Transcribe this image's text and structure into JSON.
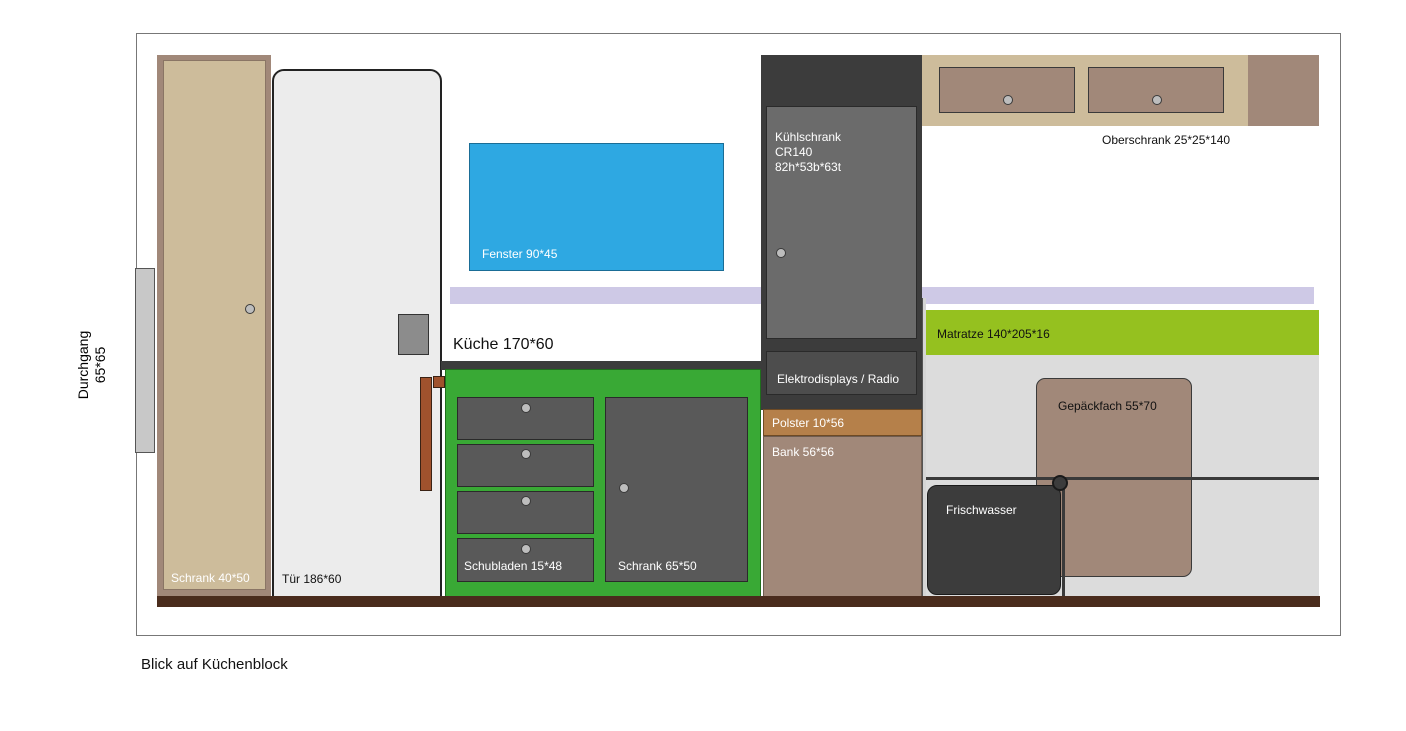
{
  "diagram": {
    "caption": "Blick auf Küchenblock",
    "passage": {
      "line1": "Durchgang",
      "line2": "65*65"
    },
    "schrank_tall": "Schrank 40*50",
    "door": "Tür 186*60",
    "window": "Fenster 90*45",
    "kitchen": "Küche 170*60",
    "drawers": "Schubladen 15*48",
    "cabinet": "Schrank 65*50",
    "fridge": {
      "line1": "Kühlschrank",
      "line2": "CR140",
      "line3": "82h*53b*63t"
    },
    "displays": "Elektrodisplays / Radio",
    "cushion": "Polster 10*56",
    "bench": "Bank 56*56",
    "upper_cabinet": "Oberschrank 25*25*140",
    "mattress": "Matratze 140*205*16",
    "luggage": "Gepäckfach 55*70",
    "freshwater": "Frischwasser"
  },
  "colors": {
    "window_blue": "#2ea8e2",
    "kitchen_green": "#39a935",
    "mattress_green": "#95c11f",
    "wood_light": "#cdbc9b",
    "wood_dark": "#a18879",
    "cushion_orange": "#b5804a",
    "floor_brown": "#4a2c1d",
    "dark_gray": "#3c3c3c",
    "mid_gray": "#6b6b6b"
  }
}
